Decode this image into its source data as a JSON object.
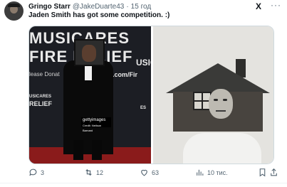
{
  "tweet": {
    "author_name": "Gringo Starr",
    "author_handle": "@JakeDuarte43",
    "separator": "·",
    "time": "15 год",
    "text": "Jaden Smith has got some competition. :)"
  },
  "media": {
    "left_backdrop": {
      "line1": "MUSICARES",
      "line2": "FIRE RELIEF",
      "line3": "lease Donat",
      "line4": "USICARES",
      "line5": "RELIEF",
      "line6": "Y.com/Fir",
      "line7": "USIC",
      "line8": "ES"
    },
    "watermark": {
      "brand": "gettyimages",
      "credit": "Credit: Neilson Barnard"
    }
  },
  "actions": {
    "reply_count": "3",
    "retweet_count": "12",
    "like_count": "63",
    "views_count": "10 тис."
  },
  "icons": {
    "x_logo": "X",
    "more": "···"
  }
}
